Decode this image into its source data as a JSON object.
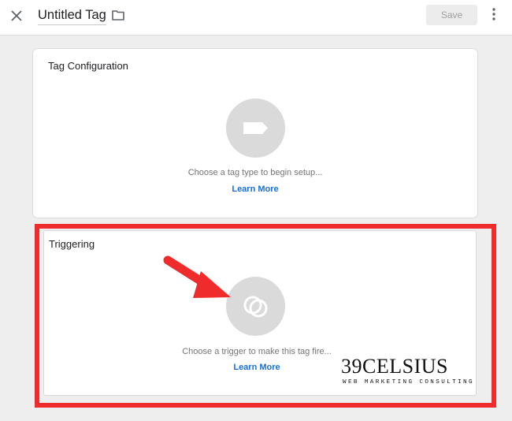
{
  "header": {
    "title": "Untitled Tag",
    "save_label": "Save",
    "icons": {
      "close": "close-icon",
      "folder": "folder-icon",
      "more": "more-vert-icon"
    }
  },
  "tag_configuration": {
    "title": "Tag Configuration",
    "hint": "Choose a tag type to begin setup...",
    "learn_more": "Learn More",
    "icon": "tag-icon"
  },
  "triggering": {
    "title": "Triggering",
    "hint": "Choose a trigger to make this tag fire...",
    "learn_more": "Learn More",
    "icon": "trigger-icon"
  },
  "annotation": {
    "frame_color": "#ef2b2b",
    "arrow_color": "#ef2b2b"
  },
  "watermark": {
    "brand": "39CELSIUS",
    "tagline": "WEB MARKETING CONSULTING"
  },
  "colors": {
    "link": "#1a6fd6",
    "background": "#eeeeee",
    "icon_circle": "#dadada"
  }
}
